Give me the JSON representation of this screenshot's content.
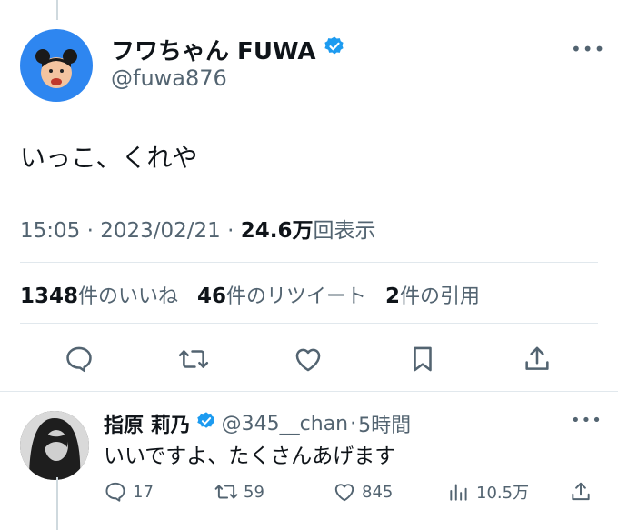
{
  "tweet": {
    "author_name": "フワちゃん FUWA",
    "author_handle": "@fuwa876",
    "text": "いっこ、くれや",
    "time": "15:05",
    "date": "2023/02/21",
    "views_count": "24.6万",
    "views_label": "回表示",
    "stats": {
      "likes_count": "1348",
      "likes_label": "件のいいね",
      "retweets_count": "46",
      "retweets_label": "件のリツイート",
      "quotes_count": "2",
      "quotes_label": "件の引用"
    },
    "actions": [
      "reply-icon",
      "retweet-icon",
      "like-icon",
      "bookmark-icon",
      "share-icon"
    ]
  },
  "reply": {
    "author_name": "指原 莉乃",
    "author_handle": "@345__chan",
    "time_ago": "5時間",
    "text": "いいですよ、たくさんあげます",
    "replies": "17",
    "retweets": "59",
    "likes": "845",
    "views": "10.5万"
  },
  "colors": {
    "verified": "#1d9bf0",
    "secondary_text": "#536471",
    "avatar_main_bg": "#2e86f0"
  }
}
